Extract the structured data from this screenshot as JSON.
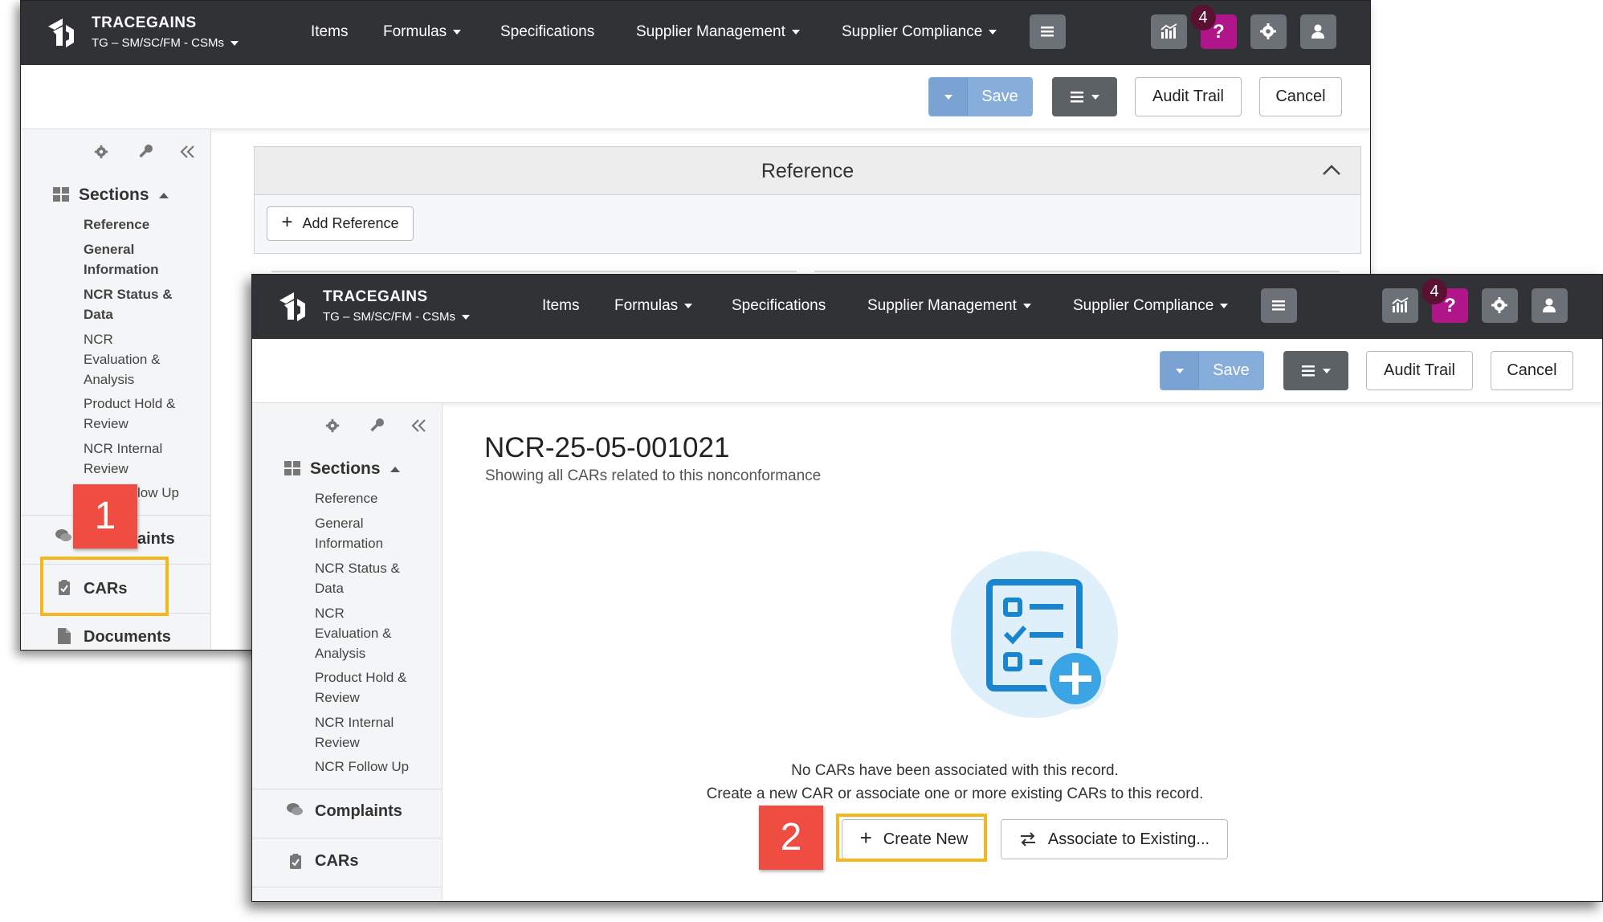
{
  "app": {
    "brand": "TRACEGAINS",
    "org": "TG – SM/SC/FM - CSMs"
  },
  "nav": {
    "items": "Items",
    "formulas": "Formulas",
    "specifications": "Specifications",
    "supplier_management": "Supplier Management",
    "supplier_compliance": "Supplier Compliance",
    "notification_count": "4",
    "help": "?"
  },
  "toolbar": {
    "save": "Save",
    "audit_trail": "Audit Trail",
    "cancel": "Cancel"
  },
  "colors": {
    "nav_bg": "#303235",
    "help": "#b0168a",
    "save": "#87aedb",
    "callout": "#ef4d41",
    "highlight": "#f4b81c"
  },
  "sidebar": {
    "sections_label": "Sections",
    "items": [
      "Reference",
      "General Information",
      "NCR Status & Data",
      "NCR Evaluation & Analysis",
      "Product Hold & Review",
      "NCR Internal Review",
      "NCR Follow Up"
    ],
    "complaints": "Complaints",
    "cars": "CARs",
    "documents": "Documents"
  },
  "win1": {
    "panel_title": "Reference",
    "add_reference": "Add Reference",
    "follow_up_partial": "low Up",
    "complaints_partial": "aints"
  },
  "win2": {
    "title": "NCR-25-05-001021",
    "subtitle": "Showing all CARs related to this nonconformance",
    "empty_line1": "No CARs have been associated with this record.",
    "empty_line2": "Create a new CAR or associate one or more existing CARs to this record.",
    "create_new": "Create New",
    "associate": "Associate to Existing..."
  },
  "callouts": {
    "step1": "1",
    "step2": "2"
  }
}
